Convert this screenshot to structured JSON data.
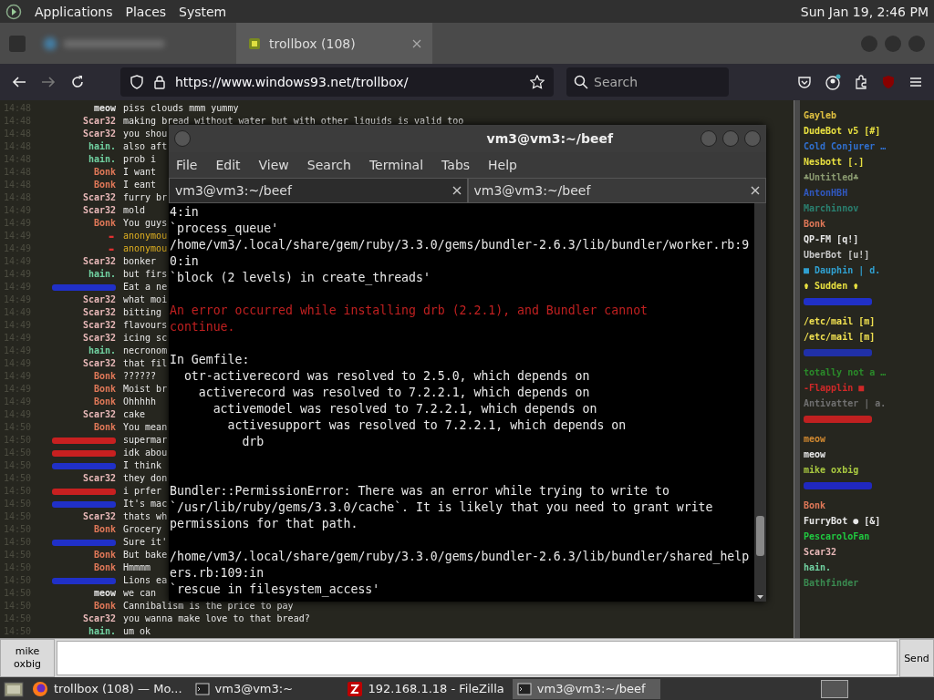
{
  "top_panel": {
    "menus": [
      "Applications",
      "Places",
      "System"
    ],
    "clock": "Sun Jan 19, 2:46 PM"
  },
  "browser": {
    "tabs": [
      {
        "kind": "blurred",
        "selected": false
      },
      {
        "kind": "normal",
        "label": "trollbox (108)",
        "selected": true
      }
    ],
    "url": "https://www.windows93.net/trollbox/",
    "search": {
      "placeholder": "Search"
    }
  },
  "chat": {
    "messages": [
      {
        "time": "14:48",
        "kind": "normal",
        "nick": "meow",
        "color": "#e8e8e8",
        "text": "piss clouds mmm yummy"
      },
      {
        "time": "14:48",
        "kind": "normal",
        "nick": "Scar32",
        "color": "#e8b8b8",
        "text": "making bread without water but with other liquids is valid too"
      },
      {
        "time": "14:48",
        "kind": "normal",
        "nick": "Scar32",
        "color": "#e8b8b8",
        "text": "you shou"
      },
      {
        "time": "14:48",
        "kind": "normal",
        "nick": "hain.",
        "color": "#70d0a0",
        "text": "also aft"
      },
      {
        "time": "14:48",
        "kind": "normal",
        "nick": "hain.",
        "color": "#70d0a0",
        "text": "prob i"
      },
      {
        "time": "14:48",
        "kind": "normal",
        "nick": "Bonk",
        "color": "#e07858",
        "text": "I want"
      },
      {
        "time": "14:48",
        "kind": "normal",
        "nick": "Bonk",
        "color": "#e07858",
        "text": "I eant"
      },
      {
        "time": "14:48",
        "kind": "normal",
        "nick": "Scar32",
        "color": "#e8b8b8",
        "text": "furry br"
      },
      {
        "time": "14:49",
        "kind": "normal",
        "nick": "Scar32",
        "color": "#e8b8b8",
        "text": "mold"
      },
      {
        "time": "14:49",
        "kind": "normal",
        "nick": "Bonk",
        "color": "#e07858",
        "text": "You guys"
      },
      {
        "time": "14:49",
        "kind": "anonymous",
        "nick": "-",
        "color": "#e03030",
        "text": "anonymou"
      },
      {
        "time": "14:49",
        "kind": "anonymous",
        "nick": "-",
        "color": "#e03030",
        "text": "anonymou"
      },
      {
        "time": "14:49",
        "kind": "normal",
        "nick": "Scar32",
        "color": "#e8b8b8",
        "text": "bonker"
      },
      {
        "time": "14:49",
        "kind": "normal",
        "nick": "hain.",
        "color": "#70d0a0",
        "text": "but firs"
      },
      {
        "time": "14:49",
        "kind": "redacted",
        "color": "#2030c8",
        "text": "Eat a ne"
      },
      {
        "time": "14:49",
        "kind": "normal",
        "nick": "Scar32",
        "color": "#e8b8b8",
        "text": "what moi"
      },
      {
        "time": "14:49",
        "kind": "normal",
        "nick": "Scar32",
        "color": "#e8b8b8",
        "text": "bitting"
      },
      {
        "time": "14:49",
        "kind": "normal",
        "nick": "Scar32",
        "color": "#e8b8b8",
        "text": "flavours"
      },
      {
        "time": "14:49",
        "kind": "normal",
        "nick": "Scar32",
        "color": "#e8b8b8",
        "text": "icing sc"
      },
      {
        "time": "14:49",
        "kind": "normal",
        "nick": "hain.",
        "color": "#70d0a0",
        "text": "necronom"
      },
      {
        "time": "14:49",
        "kind": "normal",
        "nick": "Scar32",
        "color": "#e8b8b8",
        "text": "that fil"
      },
      {
        "time": "14:49",
        "kind": "normal",
        "nick": "Bonk",
        "color": "#e07858",
        "text": "??????"
      },
      {
        "time": "14:49",
        "kind": "normal",
        "nick": "Bonk",
        "color": "#e07858",
        "text": "Moist br"
      },
      {
        "time": "14:49",
        "kind": "normal",
        "nick": "Bonk",
        "color": "#e07858",
        "text": "Ohhhhh"
      },
      {
        "time": "14:49",
        "kind": "normal",
        "nick": "Scar32",
        "color": "#e8b8b8",
        "text": "cake"
      },
      {
        "time": "14:50",
        "kind": "normal",
        "nick": "Bonk",
        "color": "#e07858",
        "text": "You mean"
      },
      {
        "time": "14:50",
        "kind": "redacted",
        "color": "#c82020",
        "text": "supermar"
      },
      {
        "time": "14:50",
        "kind": "redacted",
        "color": "#c82020",
        "text": "idk abou"
      },
      {
        "time": "14:50",
        "kind": "redacted",
        "color": "#2030c8",
        "text": "I think"
      },
      {
        "time": "14:50",
        "kind": "normal",
        "nick": "Scar32",
        "color": "#e8b8b8",
        "text": "they don"
      },
      {
        "time": "14:50",
        "kind": "redacted",
        "color": "#c82020",
        "text": "i prfer"
      },
      {
        "time": "14:50",
        "kind": "redacted",
        "color": "#2030c8",
        "text": "It's mac"
      },
      {
        "time": "14:50",
        "kind": "normal",
        "nick": "Scar32",
        "color": "#e8b8b8",
        "text": "thats wh"
      },
      {
        "time": "14:50",
        "kind": "normal",
        "nick": "Bonk",
        "color": "#e07858",
        "text": "Grocery"
      },
      {
        "time": "14:50",
        "kind": "redacted",
        "color": "#2030c8",
        "text": "Sure it'"
      },
      {
        "time": "14:50",
        "kind": "normal",
        "nick": "Bonk",
        "color": "#e07858",
        "text": "But bake"
      },
      {
        "time": "14:50",
        "kind": "normal",
        "nick": "Bonk",
        "color": "#e07858",
        "text": "Hmmmm"
      },
      {
        "time": "14:50",
        "kind": "redacted",
        "color": "#2030c8",
        "text": "Lions ea"
      },
      {
        "time": "14:50",
        "kind": "normal",
        "nick": "meow",
        "color": "#e8e8e8",
        "text": "we can"
      },
      {
        "time": "14:50",
        "kind": "normal",
        "nick": "Bonk",
        "color": "#e07858",
        "text": "Cannibalism is the price to pay"
      },
      {
        "time": "14:50",
        "kind": "normal",
        "nick": "Scar32",
        "color": "#e8b8b8",
        "text": "you wanna make love to that bread?"
      },
      {
        "time": "14:50",
        "kind": "normal",
        "nick": "hain.",
        "color": "#70d0a0",
        "text": "um ok"
      }
    ]
  },
  "users": [
    {
      "kind": "normal",
      "name": "Gayleb",
      "color": "#e0c040"
    },
    {
      "kind": "normal",
      "name": "DudeBot v5 [#]",
      "color": "#e8e040"
    },
    {
      "kind": "normal",
      "name": "Cold Conjurer …",
      "color": "#3070d0"
    },
    {
      "kind": "normal",
      "name": "Nesbott [.]",
      "color": "#e8e040"
    },
    {
      "kind": "normal",
      "name": "♣Untitled♣",
      "color": "#8a9a70"
    },
    {
      "kind": "normal",
      "name": "AntonHBH",
      "color": "#3058c0"
    },
    {
      "kind": "normal",
      "name": "Marchinnov",
      "color": "#2a8070"
    },
    {
      "kind": "normal",
      "name": "Bonk",
      "color": "#e07858"
    },
    {
      "kind": "normal",
      "name": "QP-FM [q!]",
      "color": "#e8e8e8"
    },
    {
      "kind": "normal",
      "name": "UberBot [u!]",
      "color": "#c8c8c8"
    },
    {
      "kind": "normal",
      "name": "■ Dauphin | d.",
      "color": "#30a0d0"
    },
    {
      "kind": "normal",
      "name": "⚱ Sudden ⚱",
      "color": "#e8e040"
    },
    {
      "kind": "blurred",
      "color": "#2030c8"
    },
    {
      "kind": "normal",
      "name": "/etc/mail [m]",
      "color": "#f0e050"
    },
    {
      "kind": "normal",
      "name": "/etc/mail [m]",
      "color": "#f0e050"
    },
    {
      "kind": "blurred",
      "color": "#2030a8"
    },
    {
      "kind": "normal",
      "name": "totally not a …",
      "color": "#2a8a2a"
    },
    {
      "kind": "normal",
      "name": "-Flapplin ■",
      "color": "#d02828"
    },
    {
      "kind": "normal",
      "name": "Antivatter | a.",
      "color": "#707070"
    },
    {
      "kind": "blurred",
      "color": "#c02020"
    },
    {
      "kind": "normal",
      "name": "meow",
      "color": "#d08830"
    },
    {
      "kind": "normal",
      "name": "meow",
      "color": "#e8e8e8"
    },
    {
      "kind": "normal",
      "name": "mike oxbig",
      "color": "#a8c840"
    },
    {
      "kind": "blurred",
      "color": "#2028c0"
    },
    {
      "kind": "normal",
      "name": "Bonk",
      "color": "#e07858"
    },
    {
      "kind": "normal",
      "name": "FurryBot ● [&]",
      "color": "#e8e8e8"
    },
    {
      "kind": "normal",
      "name": "PescaroloFan",
      "color": "#20c840"
    },
    {
      "kind": "normal",
      "name": "Scar32",
      "color": "#e8b8b8"
    },
    {
      "kind": "normal",
      "name": "hain.",
      "color": "#70d0a0"
    },
    {
      "kind": "normal",
      "name": "Bathfinder",
      "color": "#3a8a50"
    }
  ],
  "composer": {
    "nick": "mike oxbig",
    "send": "Send"
  },
  "terminal": {
    "title": "vm3@vm3:~/beef",
    "menus": [
      "File",
      "Edit",
      "View",
      "Search",
      "Terminal",
      "Tabs",
      "Help"
    ],
    "tabs": [
      {
        "label": "vm3@vm3:~/beef",
        "selected": true
      },
      {
        "label": "vm3@vm3:~/beef",
        "selected": false
      }
    ],
    "lines": [
      {
        "kind": "normal",
        "text": "4:in"
      },
      {
        "kind": "normal",
        "text": "`process_queue'"
      },
      {
        "kind": "normal",
        "text": "/home/vm3/.local/share/gem/ruby/3.3.0/gems/bundler-2.6.3/lib/bundler/worker.rb:9"
      },
      {
        "kind": "normal",
        "text": "0:in"
      },
      {
        "kind": "normal",
        "text": "`block (2 levels) in create_threads'"
      },
      {
        "kind": "blank"
      },
      {
        "kind": "error",
        "text": "An error occurred while installing drb (2.2.1), and Bundler cannot"
      },
      {
        "kind": "error",
        "text": "continue."
      },
      {
        "kind": "blank"
      },
      {
        "kind": "normal",
        "text": "In Gemfile:"
      },
      {
        "kind": "normal",
        "text": "  otr-activerecord was resolved to 2.5.0, which depends on"
      },
      {
        "kind": "normal",
        "text": "    activerecord was resolved to 7.2.2.1, which depends on"
      },
      {
        "kind": "normal",
        "text": "      activemodel was resolved to 7.2.2.1, which depends on"
      },
      {
        "kind": "normal",
        "text": "        activesupport was resolved to 7.2.2.1, which depends on"
      },
      {
        "kind": "normal",
        "text": "          drb"
      },
      {
        "kind": "blank"
      },
      {
        "kind": "blank"
      },
      {
        "kind": "normal",
        "text": "Bundler::PermissionError: There was an error while trying to write to"
      },
      {
        "kind": "normal",
        "text": "`/usr/lib/ruby/gems/3.3.0/cache`. It is likely that you need to grant write"
      },
      {
        "kind": "normal",
        "text": "permissions for that path."
      },
      {
        "kind": "blank"
      },
      {
        "kind": "normal",
        "text": "/home/vm3/.local/share/gem/ruby/3.3.0/gems/bundler-2.6.3/lib/bundler/shared_help"
      },
      {
        "kind": "normal",
        "text": "ers.rb:109:in"
      },
      {
        "kind": "normal",
        "text": "`rescue in filesystem_access'"
      }
    ]
  },
  "taskbar": {
    "items": [
      {
        "kind": "firefox",
        "label": "trollbox (108) — Mo...",
        "selected": false
      },
      {
        "kind": "terminal",
        "label": "vm3@vm3:~",
        "selected": false
      },
      {
        "kind": "filezilla",
        "label": "192.168.1.18 - FileZilla",
        "selected": false
      },
      {
        "kind": "terminal",
        "label": "vm3@vm3:~/beef",
        "selected": true
      }
    ]
  }
}
